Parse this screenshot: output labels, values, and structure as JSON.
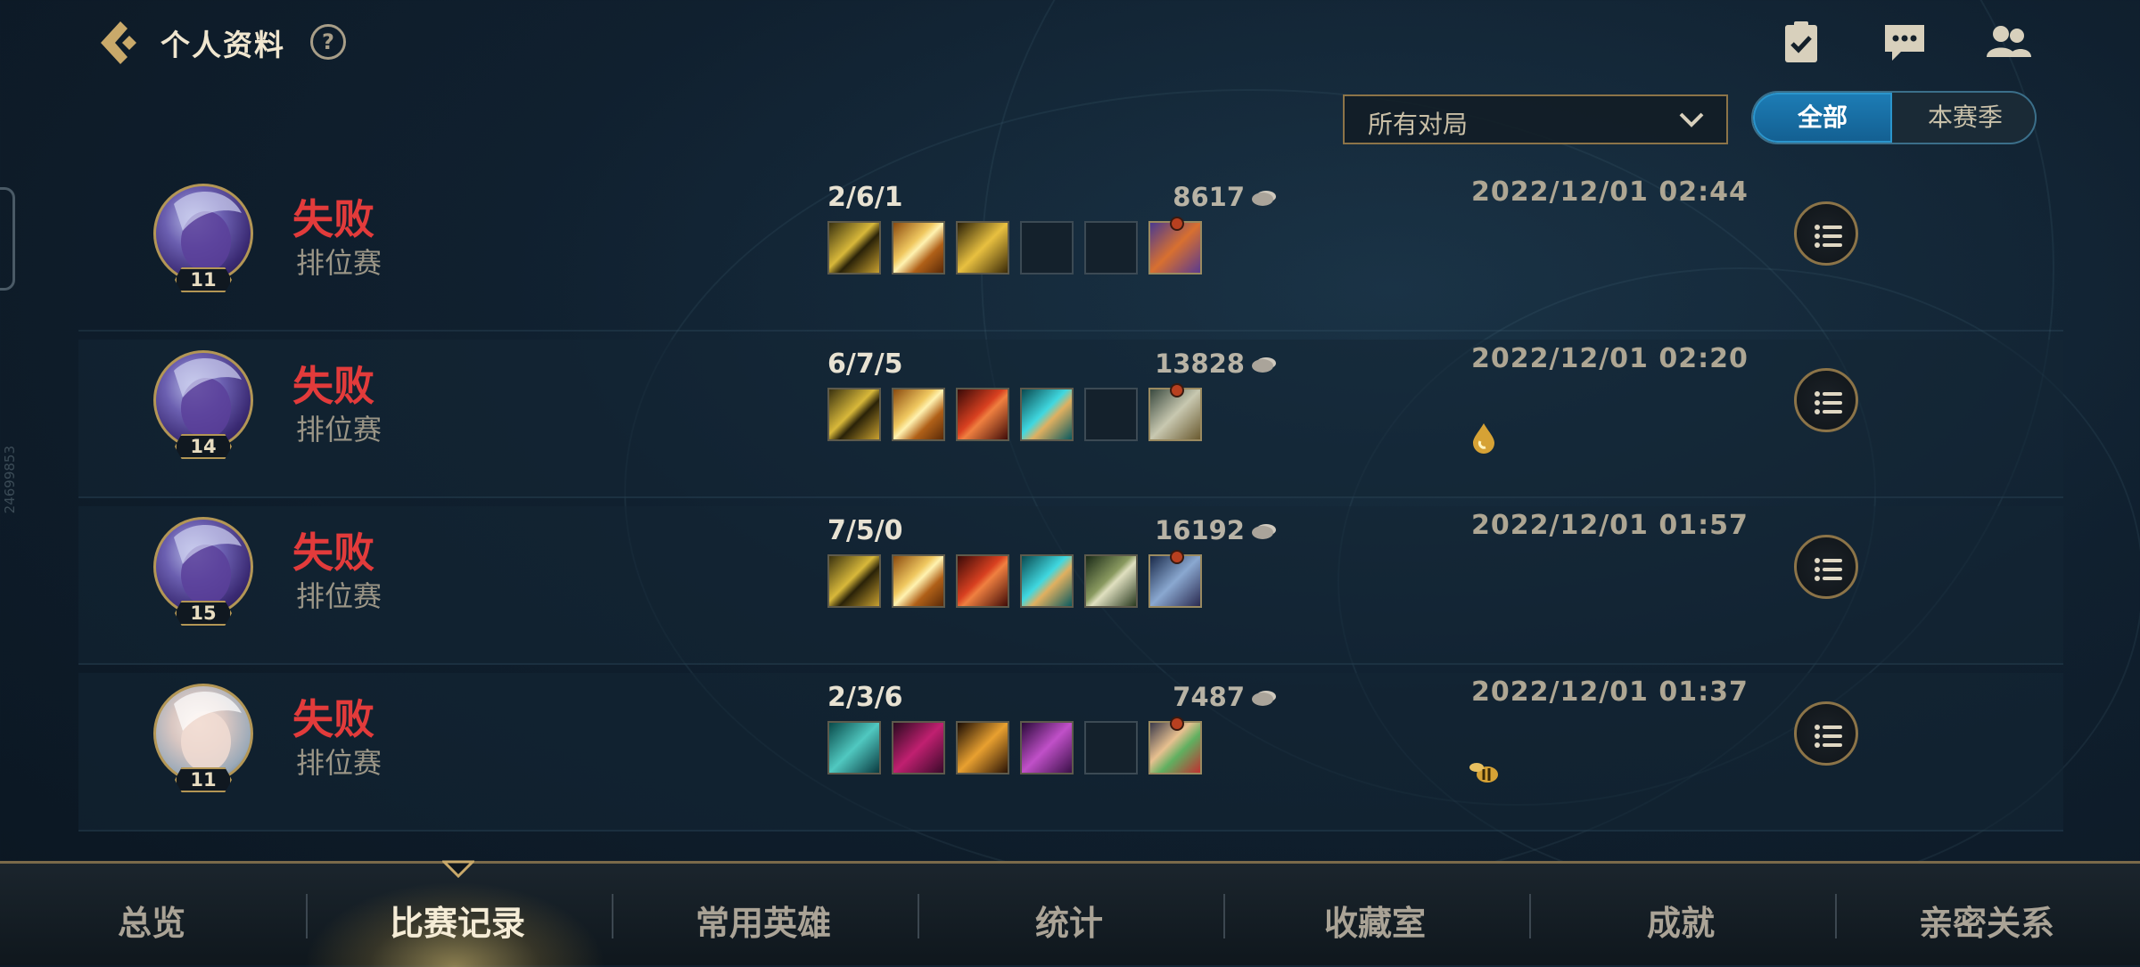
{
  "header": {
    "title": "个人资料",
    "help": "?"
  },
  "filter": {
    "dropdown_value": "所有对局",
    "segments": [
      "全部",
      "本赛季"
    ]
  },
  "side_code": "24699853",
  "matches": [
    {
      "result": "失败",
      "mode": "排位赛",
      "level": "11",
      "kda": "2/6/1",
      "gold": "8617",
      "date": "2022/12/01 02:44",
      "avatar": "purple",
      "badge": null,
      "items": [
        "sword-gold",
        "sword-lightning",
        "crossbow-gold",
        "empty",
        "empty",
        "trinket-purple"
      ]
    },
    {
      "result": "失败",
      "mode": "排位赛",
      "level": "14",
      "kda": "6/7/5",
      "gold": "13828",
      "date": "2022/12/01 02:20",
      "avatar": "purple",
      "badge": "drop-icon",
      "items": [
        "sword-gold",
        "sword-lightning",
        "blade-red",
        "gauntlet-cyan",
        "empty",
        "trinket-silver"
      ]
    },
    {
      "result": "失败",
      "mode": "排位赛",
      "level": "15",
      "kda": "7/5/0",
      "gold": "16192",
      "date": "2022/12/01 01:57",
      "avatar": "purple",
      "badge": null,
      "items": [
        "sword-gold",
        "sword-lightning",
        "blade-red",
        "gauntlet-cyan",
        "blade-green",
        "trinket-blue"
      ]
    },
    {
      "result": "失败",
      "mode": "排位赛",
      "level": "11",
      "kda": "2/3/6",
      "gold": "7487",
      "date": "2022/12/01 01:37",
      "avatar": "light",
      "badge": "bee-icon",
      "items": [
        "staff-cyan",
        "armor-magenta",
        "torch-gold",
        "orb-purple",
        "empty",
        "feather-multi"
      ]
    }
  ],
  "nav": [
    "总览",
    "比赛记录",
    "常用英雄",
    "统计",
    "收藏室",
    "成就",
    "亲密关系"
  ],
  "nav_active": 1,
  "colors": {
    "defeat": "#e23b3b",
    "accent": "#1d7db6",
    "gold_border": "#b39655"
  }
}
